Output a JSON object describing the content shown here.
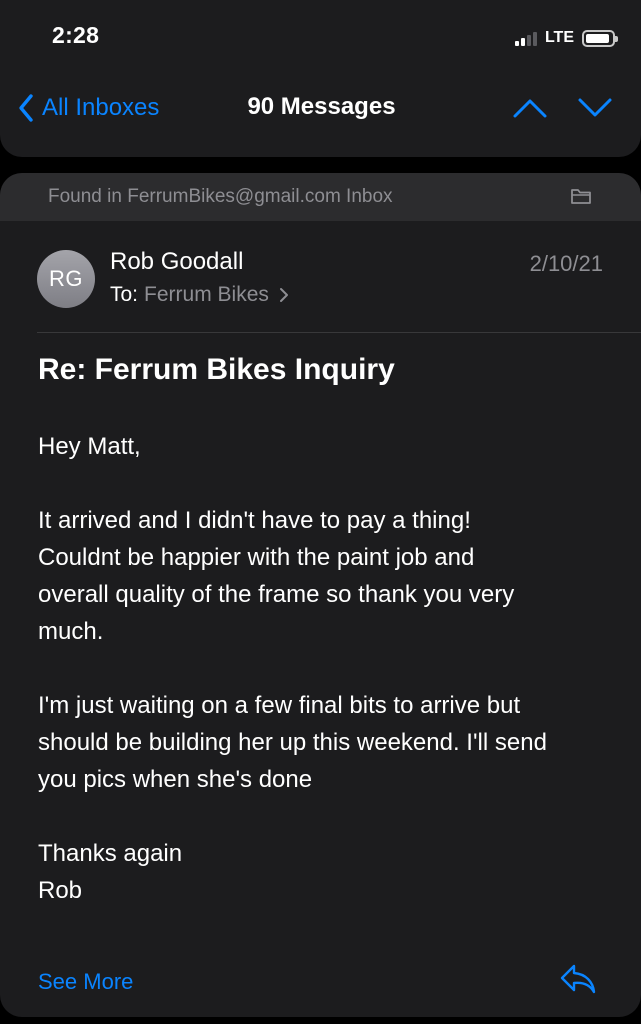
{
  "status_bar": {
    "time": "2:28",
    "network": "LTE"
  },
  "nav": {
    "back_label": "All Inboxes",
    "title": "90 Messages"
  },
  "email": {
    "found_in": "Found in FerrumBikes@gmail.com Inbox",
    "avatar_initials": "RG",
    "sender": "Rob Goodall",
    "to_prefix": "To:",
    "to_recipient": "Ferrum Bikes",
    "date": "2/10/21",
    "subject": "Re: Ferrum Bikes Inquiry",
    "body": {
      "greeting": "Hey Matt,",
      "para1": [
        "It arrived and I didn't have to pay a thing!",
        "Couldnt be happier with the paint job and",
        "overall quality of the frame so thank you very",
        "much."
      ],
      "para2": [
        "I'm just waiting on a few final bits to arrive but",
        "should be building her up this weekend. I'll send",
        "you pics when she's done"
      ],
      "signoff": [
        "Thanks again",
        "Rob"
      ]
    },
    "see_more_label": "See More"
  },
  "colors": {
    "accent": "#0a84ff",
    "background": "#000000",
    "card": "#1c1c1e",
    "banner": "#2c2c2e",
    "secondary_text": "#8e8e93"
  },
  "icons": {
    "back": "chevron-left-icon",
    "prev": "chevron-up-icon",
    "next": "chevron-down-icon",
    "folder": "folder-icon",
    "reply": "reply-icon"
  }
}
